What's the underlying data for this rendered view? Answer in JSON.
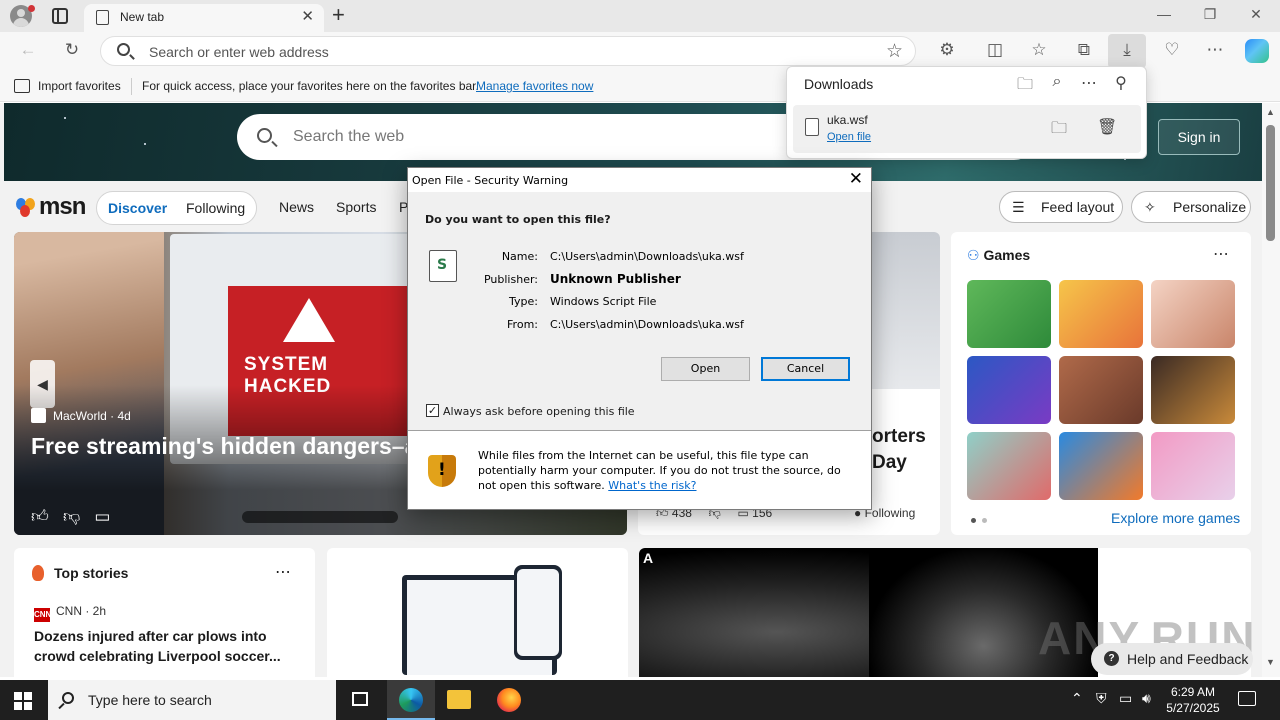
{
  "browser": {
    "tab_title": "New tab",
    "address_placeholder": "Search or enter web address",
    "favorites_bar": {
      "import_label": "Import favorites",
      "message": "For quick access, place your favorites here on the favorites bar.",
      "manage_link": "Manage favorites now"
    }
  },
  "downloads": {
    "title": "Downloads",
    "item": {
      "file_name": "uka.wsf",
      "open_link": "Open file"
    }
  },
  "msn": {
    "search_placeholder": "Search the web",
    "sign_in": "Sign in",
    "logo": "msn",
    "tabs": {
      "discover": "Discover",
      "following": "Following"
    },
    "nav": [
      "News",
      "Sports",
      "P"
    ],
    "feed_layout": "Feed layout",
    "personalize": "Personalize",
    "main_story": {
      "source": "MacWorld · 4d",
      "headline": "Free streaming's hidden dangers–a your Mac",
      "image_text": "SYSTEM HACKED"
    },
    "right_story": {
      "headline_fragment": "orters\nDay",
      "likes": "438",
      "comments": "156",
      "follow_label": "Following"
    },
    "games": {
      "title": "Games",
      "explore": "Explore more games"
    },
    "top_stories": {
      "title": "Top stories",
      "source": "CNN · 2h",
      "source_logo": "CNN",
      "headline": "Dozens injured after car plows into crowd celebrating Liverpool soccer..."
    },
    "mri_label": "A",
    "help_feedback": "Help and Feedback",
    "watermark": "ANY.RUN"
  },
  "dialog": {
    "title": "Open File - Security Warning",
    "question": "Do you want to open this file?",
    "fields": {
      "name_label": "Name:",
      "name_value": "C:\\Users\\admin\\Downloads\\uka.wsf",
      "publisher_label": "Publisher:",
      "publisher_value": "Unknown Publisher",
      "type_label": "Type:",
      "type_value": "Windows Script File",
      "from_label": "From:",
      "from_value": "C:\\Users\\admin\\Downloads\\uka.wsf"
    },
    "open_button": "Open",
    "cancel_button": "Cancel",
    "checkbox_label": "Always ask before opening this file",
    "checkbox_checked": true,
    "warning_text": "While files from the Internet can be useful, this file type can potentially harm your computer. If you do not trust the source, do not open this software.",
    "risk_link": "What's the risk?"
  },
  "taskbar": {
    "search_placeholder": "Type here to search",
    "time": "6:29 AM",
    "date": "5/27/2025"
  },
  "colors": {
    "accent": "#0f6cbd",
    "dialog_default_border": "#0078d7",
    "taskbar": "#1f1f1f"
  }
}
